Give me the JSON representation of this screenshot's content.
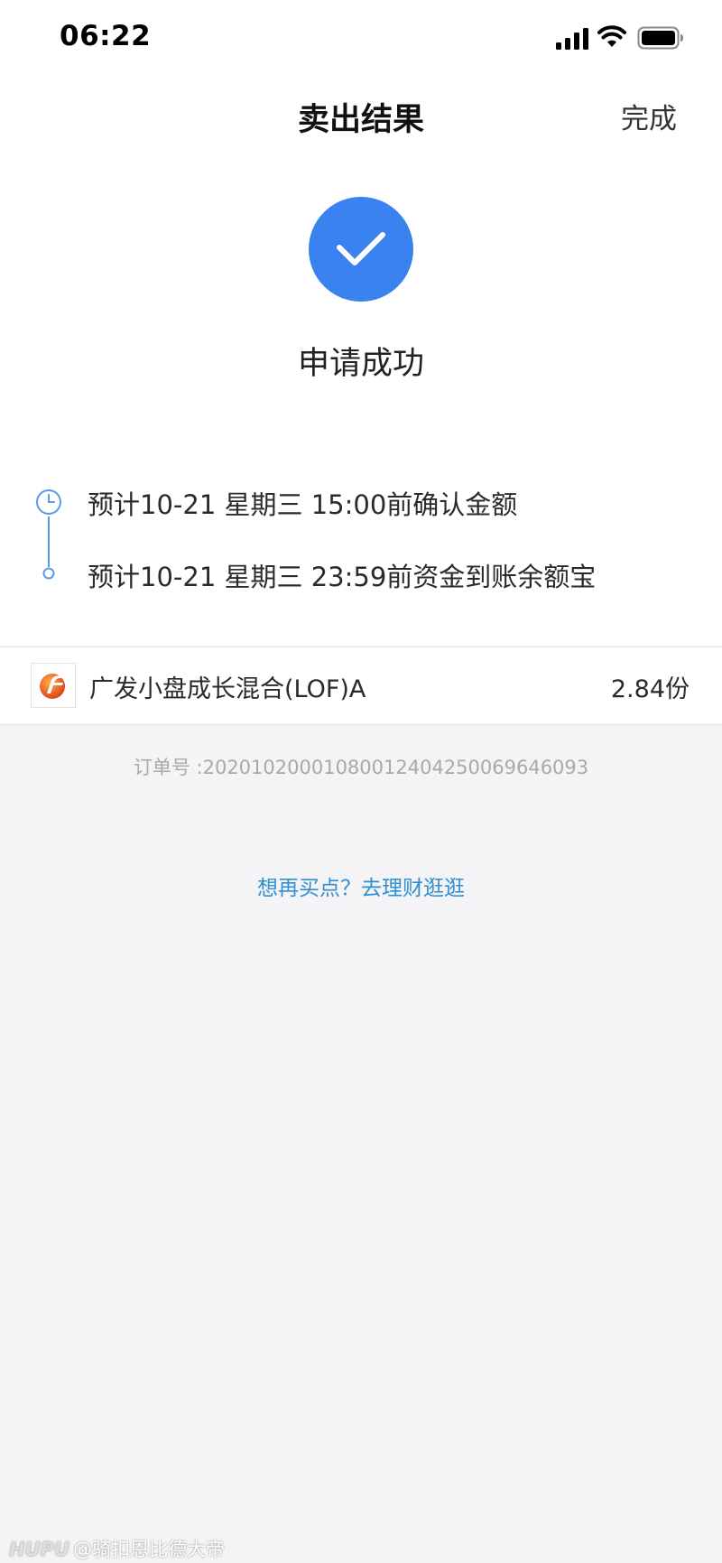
{
  "status_bar": {
    "time": "06:22",
    "icons": [
      "cellular-signal-icon",
      "wifi-icon",
      "battery-icon"
    ]
  },
  "nav": {
    "title": "卖出结果",
    "done_label": "完成"
  },
  "result": {
    "icon": "checkmark-icon",
    "title": "申请成功",
    "accent_color": "#3a82f0"
  },
  "timeline": {
    "steps": [
      {
        "icon": "clock-icon",
        "text": "预计10-21 星期三 15:00前确认金额"
      },
      {
        "icon": "dot-icon",
        "text": "预计10-21 星期三 23:59前资金到账余额宝"
      }
    ]
  },
  "fund": {
    "logo": "fund-company-logo",
    "name": "广发小盘成长混合(LOF)A",
    "shares": "2.84份"
  },
  "order": {
    "number_text": "订单号 :2020102000108001240425006964609​3"
  },
  "more_link": {
    "label": "想再买点？去理财逛逛",
    "color": "#2f8fd0"
  },
  "watermark": {
    "logo": "HUPU",
    "text": "@骑扣恩比德大帝"
  }
}
